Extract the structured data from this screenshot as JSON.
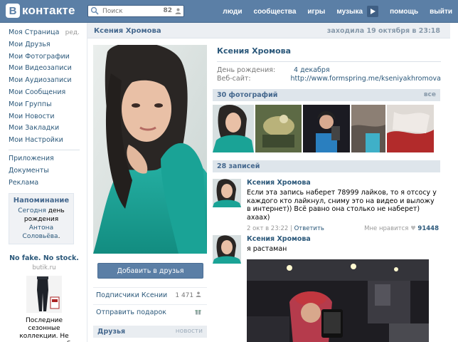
{
  "header": {
    "logo_letter": "B",
    "logo_text": "контакте",
    "search_placeholder": "Поиск",
    "search_count": "82",
    "nav": [
      "люди",
      "сообщества",
      "игры",
      "музыка",
      "помощь",
      "выйти"
    ]
  },
  "sidebar": {
    "items": [
      "Моя Страница",
      "Мои Друзья",
      "Мои Фотографии",
      "Мои Видеозаписи",
      "Мои Аудиозаписи",
      "Мои Сообщения",
      "Мои Группы",
      "Мои Новости",
      "Мои Закладки",
      "Мои Настройки"
    ],
    "edit_label": "ред.",
    "extra": [
      "Приложения",
      "Документы",
      "Реклама"
    ],
    "reminder": {
      "title": "Напоминание",
      "today": "Сегодня",
      "text_mid": " день рождения ",
      "person": "Антона Соловьёва",
      "end": "."
    },
    "ad": {
      "title": "No fake. No stock.",
      "domain": "butik.ru",
      "text": "Последние сезонные коллекции. Не экономьте на себе."
    }
  },
  "page": {
    "name": "Ксения Хромова",
    "status": "заходила 19 октября в 23:18"
  },
  "profile": {
    "name": "Ксения Хромова",
    "rows": [
      {
        "k": "День рождения:",
        "v": "4 декабря"
      },
      {
        "k": "Веб-сайт:",
        "v": "http://www.formspring.me/kseniyakhromova"
      }
    ]
  },
  "left_column": {
    "add_friend": "Добавить в друзья",
    "subscribers_label": "Подписчики Ксении",
    "subscribers_count": "1 471",
    "gift_label": "Отправить подарок",
    "friends_title": "Друзья",
    "friends_right": "новости"
  },
  "photos": {
    "title": "30 фотографий",
    "all": "все"
  },
  "wall": {
    "title": "28 записей",
    "posts": [
      {
        "author": "Ксения Хромова",
        "text": "Если эта запись наберет 78999 лайков, то я отсосу у каждого кто лайкнул, сниму это на видео и выложу в интернет)) Всё равно она столько не наберет) ахаах)",
        "date": "2 окт в 23:22",
        "reply": "Ответить",
        "like_label": "Мне нравится",
        "likes": "91448"
      },
      {
        "author": "Ксения Хромова",
        "text": "я растаман"
      }
    ]
  },
  "colors": {
    "header_blue": "#5b7fa6",
    "link": "#2b587a",
    "section_bg": "#dee5eb"
  }
}
